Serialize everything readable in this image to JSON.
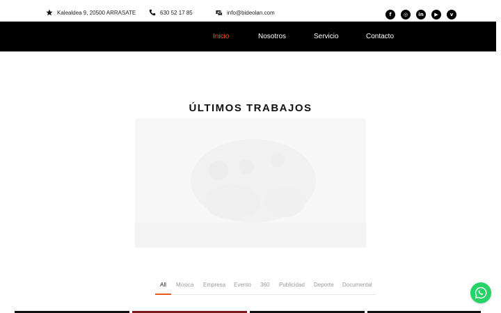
{
  "topbar": {
    "address": "Kalealdea 9, 20500 ARRASATE",
    "phone": "630 52 17 85",
    "email": "info@bideolan.com",
    "address_icon": "star-icon",
    "phone_icon": "phone-icon",
    "email_icon": "email-icon"
  },
  "social": [
    {
      "icon": "facebook-icon",
      "glyph": "f"
    },
    {
      "icon": "instagram-icon",
      "glyph": "◎"
    },
    {
      "icon": "linkedin-icon",
      "glyph": "in"
    },
    {
      "icon": "youtube-icon",
      "glyph": "▶"
    },
    {
      "icon": "vimeo-icon",
      "glyph": "v"
    }
  ],
  "nav": {
    "items": [
      "Inicio",
      "Nosotros",
      "Servicio",
      "Contacto"
    ],
    "active": "Inicio"
  },
  "main": {
    "title": "ÚLTIMOS TRABAJOS"
  },
  "filters": {
    "items": [
      "All",
      "Música",
      "Empresa",
      "Evento",
      "360",
      "Publicidad",
      "Deporte",
      "Documental"
    ],
    "active": "All"
  },
  "colors": {
    "accent": "#e8581c",
    "navbar": "#000000",
    "whatsapp": "#25d366"
  }
}
